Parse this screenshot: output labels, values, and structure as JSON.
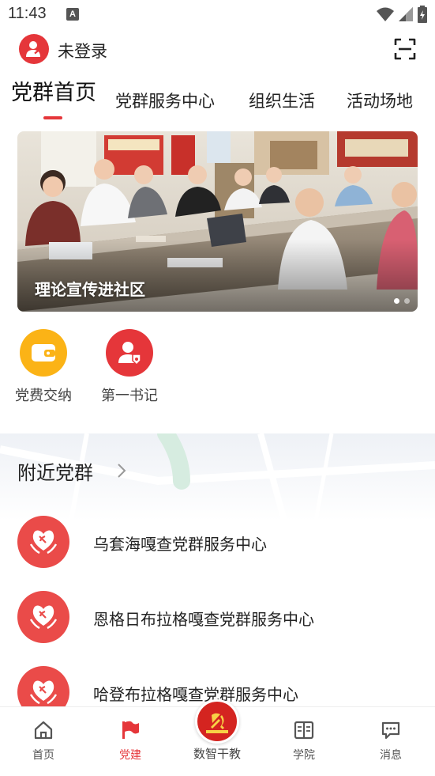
{
  "status_bar": {
    "time": "11:43",
    "notification_letter": "A"
  },
  "header": {
    "login_status": "未登录"
  },
  "tabs": [
    {
      "label": "党群首页",
      "active": true
    },
    {
      "label": "党群服务中心",
      "active": false
    },
    {
      "label": "组织生活",
      "active": false
    },
    {
      "label": "活动场地",
      "active": false
    }
  ],
  "banner": {
    "caption": "理论宣传进社区",
    "page_count": 2,
    "current_page": 1
  },
  "quick_actions": [
    {
      "label": "党费交纳",
      "icon": "wallet-icon",
      "color": "#fbb316"
    },
    {
      "label": "第一书记",
      "icon": "secretary-badge-icon",
      "color": "#e5363a"
    }
  ],
  "nearby": {
    "title": "附近党群",
    "items": [
      {
        "name": "乌套海嘎查党群服务中心"
      },
      {
        "name": "恩格日布拉格嘎查党群服务中心"
      },
      {
        "name": "哈登布拉格嘎查党群服务中心"
      }
    ]
  },
  "bottom_nav": {
    "items": [
      {
        "label": "首页",
        "icon": "home-icon",
        "active": false
      },
      {
        "label": "党建",
        "icon": "flag-icon",
        "active": true
      },
      {
        "label": "数智干教",
        "icon": "party-emblem-icon",
        "active": false
      },
      {
        "label": "学院",
        "icon": "book-icon",
        "active": false
      },
      {
        "label": "消息",
        "icon": "message-icon",
        "active": false
      }
    ]
  },
  "colors": {
    "accent": "#e5363a",
    "wallet": "#fbb316",
    "org_icon": "#ea4b49"
  }
}
